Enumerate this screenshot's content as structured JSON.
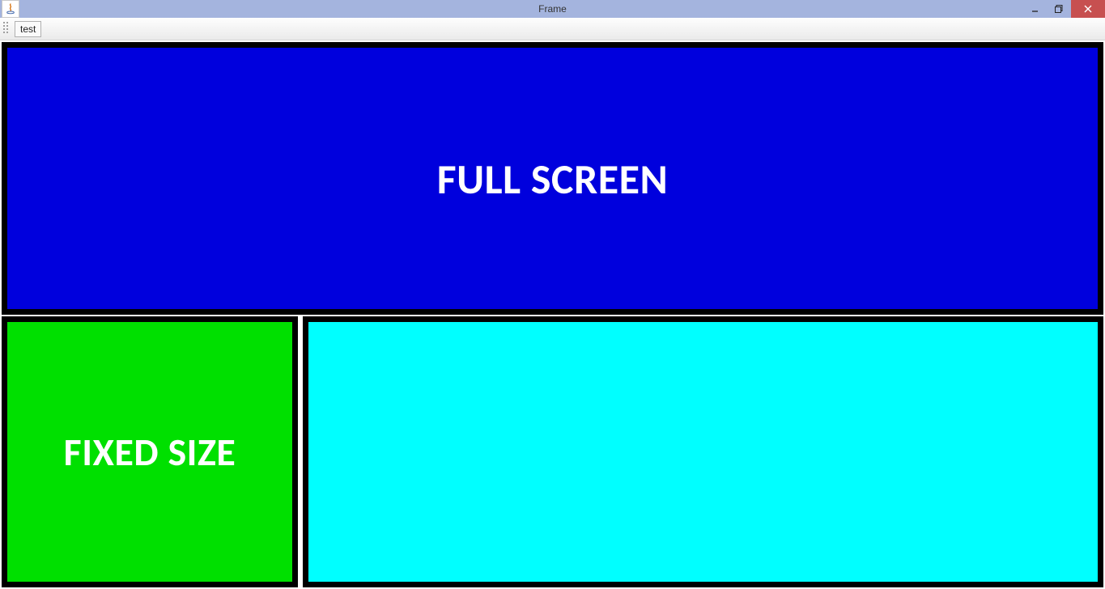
{
  "window": {
    "title": "Frame"
  },
  "toolbar": {
    "button_label": "test"
  },
  "panels": {
    "full_screen_label": "FULL SCREEN",
    "fixed_size_label": "FIXED SIZE"
  }
}
